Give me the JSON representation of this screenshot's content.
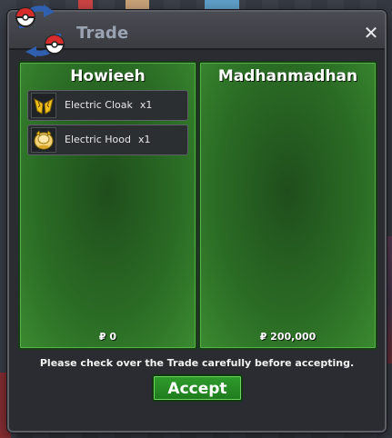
{
  "window": {
    "title": "Trade",
    "close_glyph": "✕"
  },
  "left_trader": {
    "name": "Howieeh",
    "items": [
      {
        "name": "Electric Cloak",
        "qty": "x1",
        "icon": "electric-cloak-icon"
      },
      {
        "name": "Electric Hood",
        "qty": "x1",
        "icon": "electric-hood-icon"
      }
    ],
    "money": "₽ 0"
  },
  "right_trader": {
    "name": "Madhanmadhan",
    "items": [],
    "money": "₽ 200,000"
  },
  "notice": "Please check over the Trade carefully before accepting.",
  "accept_label": "Accept",
  "colors": {
    "panel_green": "#2b6d25",
    "accept_green": "#2f9c2c",
    "title_text": "#9aa3b2"
  }
}
